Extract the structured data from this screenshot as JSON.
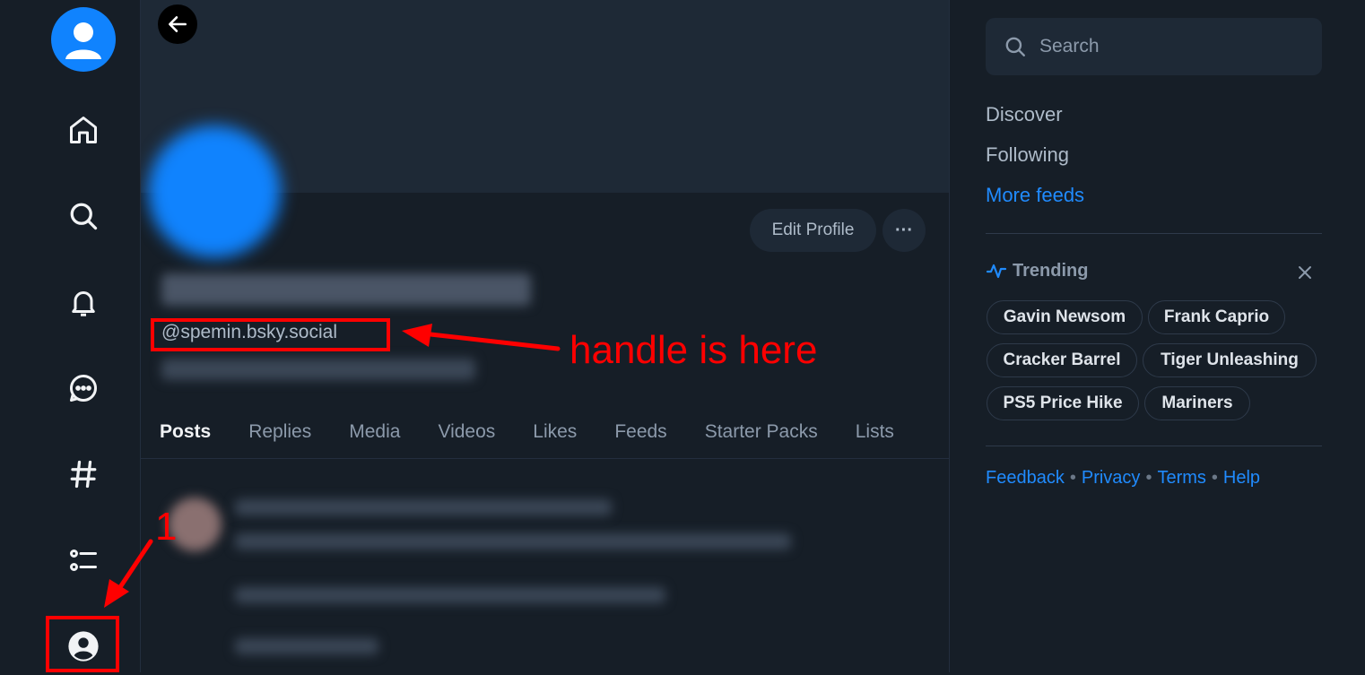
{
  "nav": {
    "items": [
      {
        "name": "home-icon"
      },
      {
        "name": "search-icon"
      },
      {
        "name": "bell-icon"
      },
      {
        "name": "chat-icon"
      },
      {
        "name": "hashtag-icon"
      },
      {
        "name": "lists-icon"
      },
      {
        "name": "profile-icon"
      }
    ],
    "accent": "#1083fe"
  },
  "profile": {
    "handle": "@spemin.bsky.social",
    "edit_label": "Edit Profile",
    "more_label": "···"
  },
  "tabs": [
    "Posts",
    "Replies",
    "Media",
    "Videos",
    "Likes",
    "Feeds",
    "Starter Packs",
    "Lists"
  ],
  "sidebar": {
    "search_placeholder": "Search",
    "feeds": [
      "Discover",
      "Following"
    ],
    "more_feeds": "More feeds",
    "trending_title": "Trending",
    "trending": [
      "Gavin Newsom",
      "Frank Caprio",
      "Cracker Barrel",
      "Tiger Unleashing",
      "PS5 Price Hike",
      "Mariners"
    ],
    "footer_links": [
      "Feedback",
      "Privacy",
      "Terms",
      "Help"
    ],
    "link_color": "#208bfe"
  },
  "annotations": {
    "handle_note": "handle is here",
    "step_number": "1",
    "color": "#ff0000"
  }
}
